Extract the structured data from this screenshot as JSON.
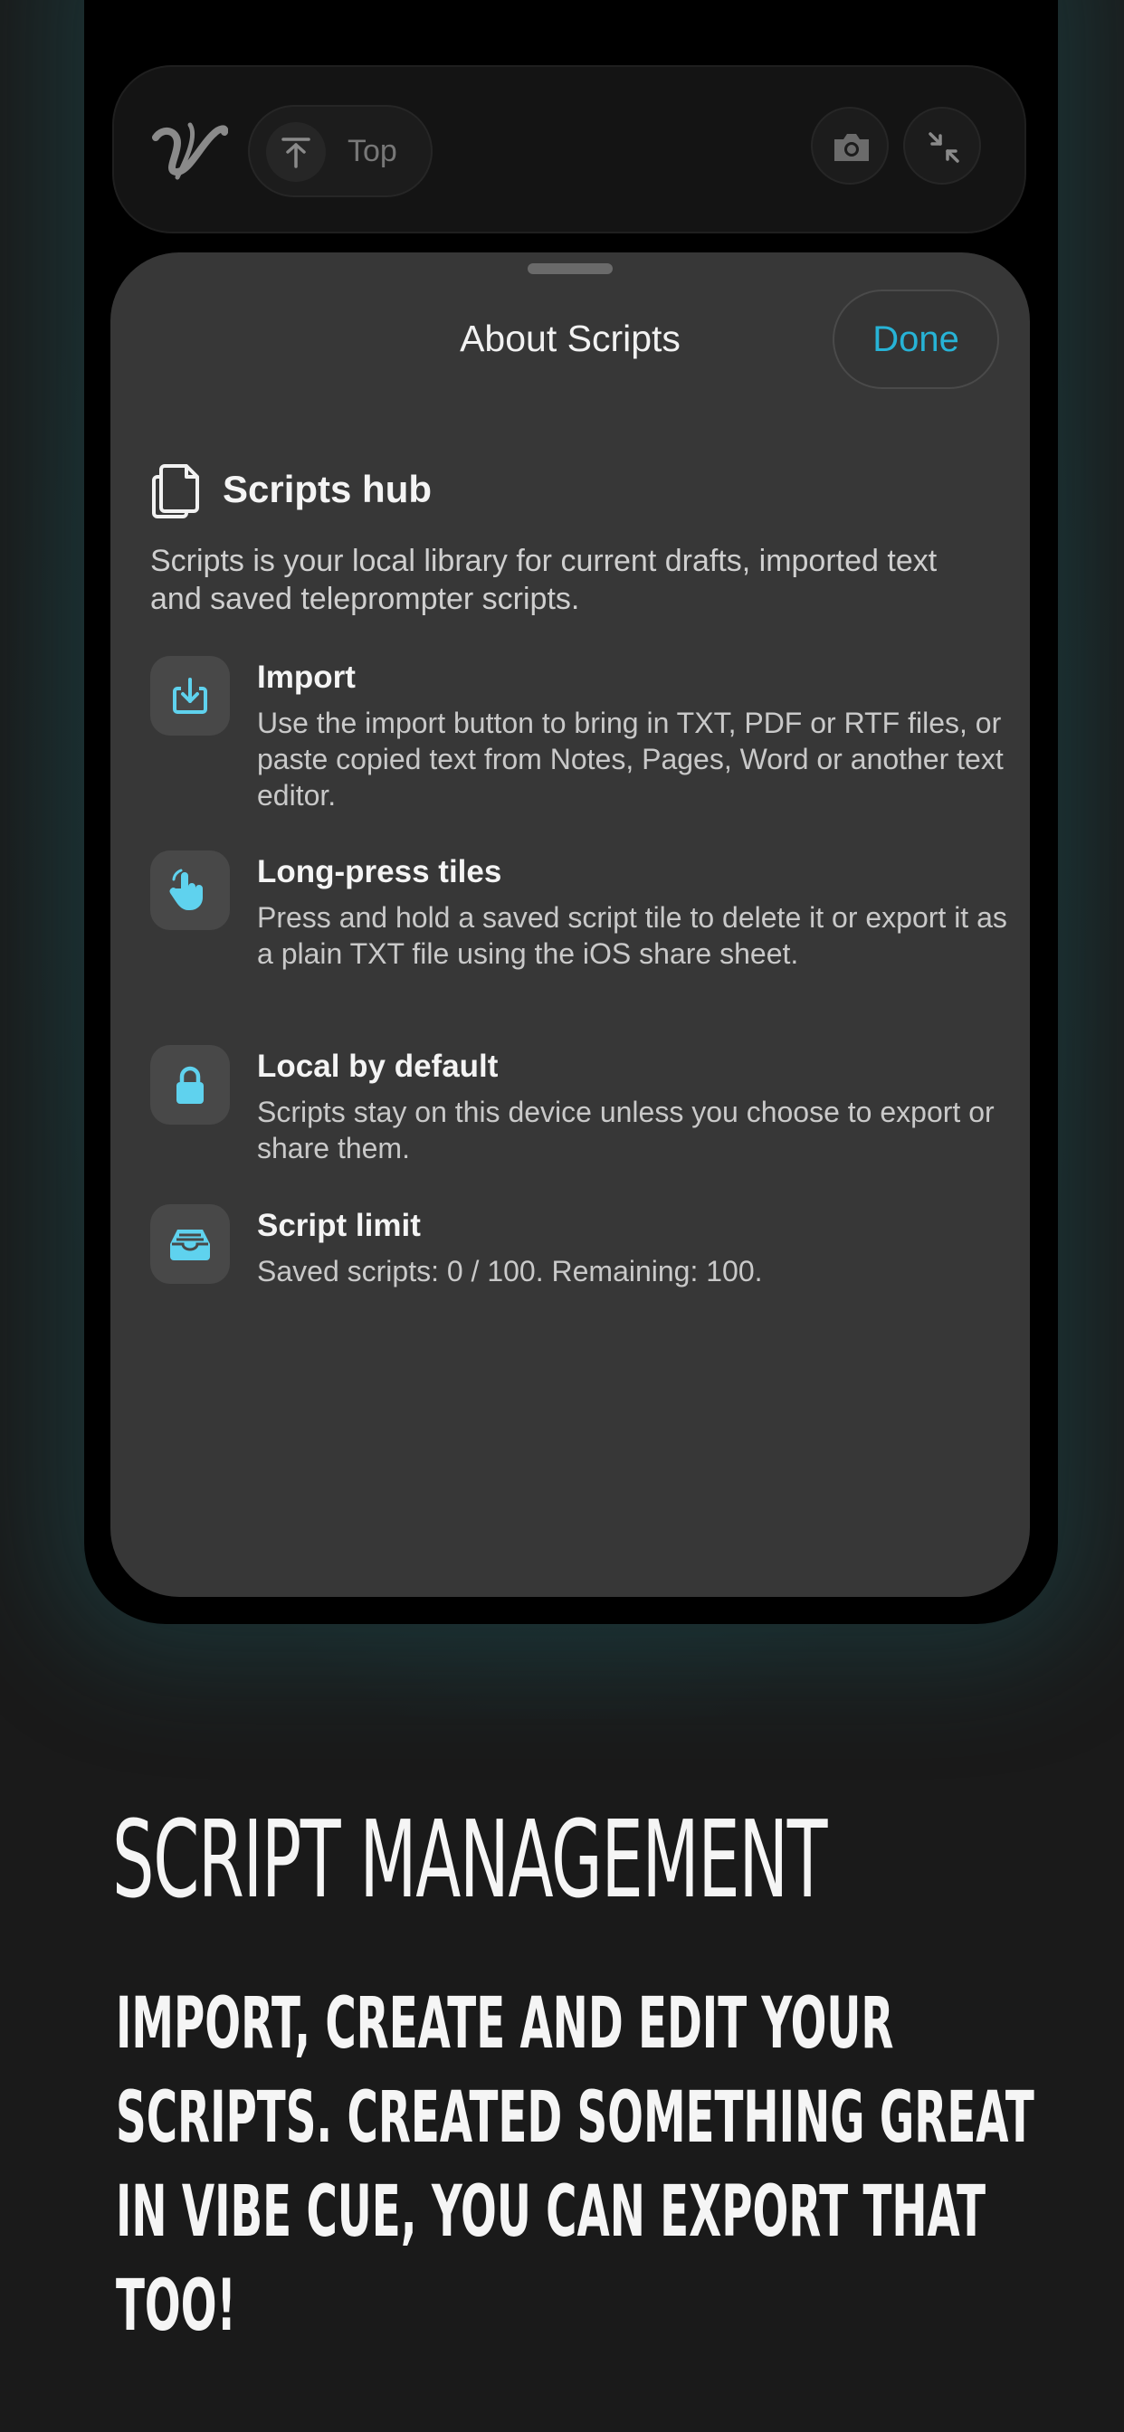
{
  "topbar": {
    "top_label": "Top"
  },
  "sheet": {
    "title": "About Scripts",
    "done_label": "Done",
    "hub": {
      "title": "Scripts hub",
      "description": "Scripts is your local library for current drafts, imported text and saved teleprompter scripts."
    },
    "items": [
      {
        "icon": "import-icon",
        "title": "Import",
        "description": "Use the import button to bring in TXT, PDF or RTF files, or paste copied text from Notes, Pages, Word or another text editor."
      },
      {
        "icon": "hand-press-icon",
        "title": "Long-press tiles",
        "description": "Press and hold a saved script tile to delete it or export it as a plain TXT file using the iOS share sheet."
      },
      {
        "icon": "lock-icon",
        "title": "Local by default",
        "description": "Scripts stay on this device unless you choose to export or share them."
      },
      {
        "icon": "tray-icon",
        "title": "Script limit",
        "description": "Saved scripts: 0 / 100. Remaining: 100."
      }
    ]
  },
  "marketing": {
    "headline": "SCRIPT MANAGEMENT",
    "subheadline": "IMPORT, CREATE AND EDIT YOUR SCRIPTS. CREATED SOMETHING GREAT IN VIBE CUE, YOU CAN EXPORT THAT TOO!"
  },
  "colors": {
    "accent": "#27b3d6",
    "icon_accent": "#5fd2ee",
    "sheet_bg": "#373737",
    "page_bg": "#1a1a1a"
  }
}
